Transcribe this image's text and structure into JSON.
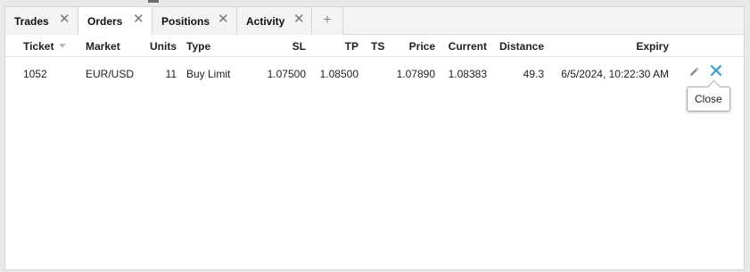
{
  "tabs": [
    {
      "label": "Trades",
      "closable": true
    },
    {
      "label": "Orders",
      "closable": true,
      "active": true
    },
    {
      "label": "Positions",
      "closable": true
    },
    {
      "label": "Activity",
      "closable": true
    }
  ],
  "add_tab_icon": "plus-icon",
  "columns": {
    "ticket": "Ticket",
    "market": "Market",
    "units": "Units",
    "type": "Type",
    "sl": "SL",
    "tp": "TP",
    "ts": "TS",
    "price": "Price",
    "current": "Current",
    "distance": "Distance",
    "expiry": "Expiry"
  },
  "orders": [
    {
      "ticket": "1052",
      "market": "EUR/USD",
      "units": "11",
      "type": "Buy Limit",
      "sl": "1.07500",
      "tp": "1.08500",
      "ts": "",
      "price": "1.07890",
      "current": "1.08383",
      "distance": "49.3",
      "expiry": "6/5/2024, 10:22:30 AM"
    }
  ],
  "row_actions": {
    "edit_icon": "pencil-icon",
    "close_icon": "close-icon"
  },
  "tooltip": {
    "text": "Close"
  },
  "colors": {
    "accent": "#2e9bd6",
    "tab_close": "#777777"
  }
}
